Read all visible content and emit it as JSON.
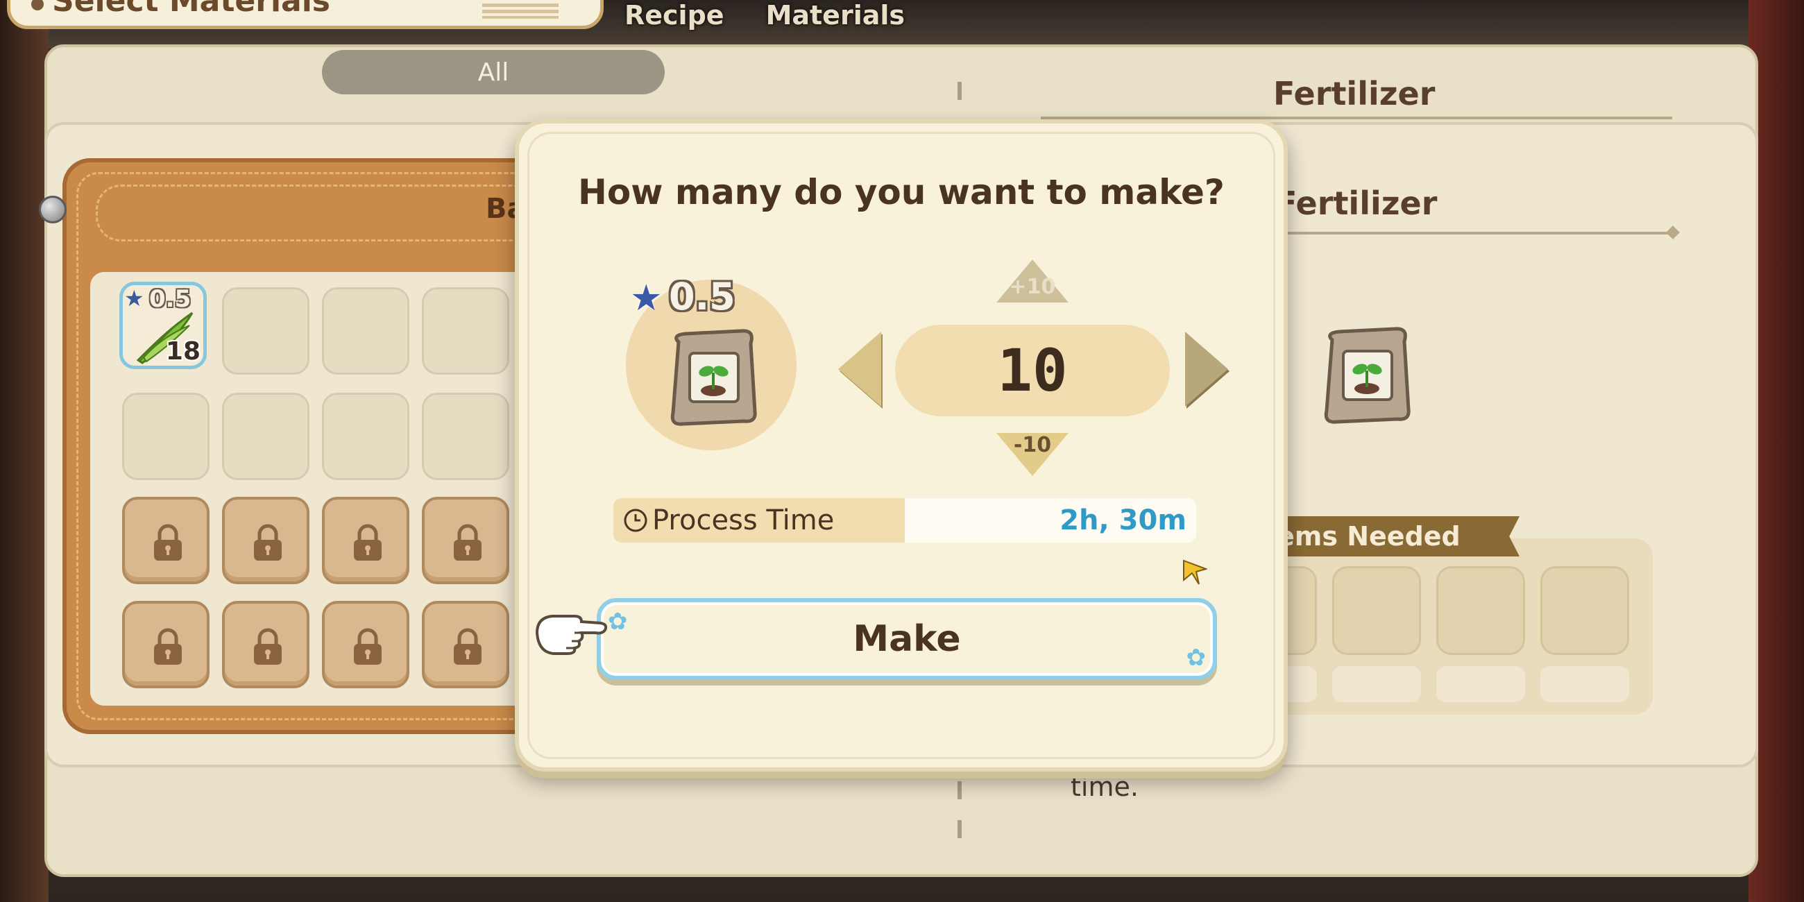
{
  "header": {
    "title": "Select Materials",
    "tabs": [
      {
        "label": "Recipe"
      },
      {
        "label": "Materials"
      }
    ]
  },
  "filter": {
    "all_label": "All"
  },
  "bag": {
    "label": "Ba",
    "items": [
      {
        "rating": "0.5",
        "count": "18",
        "icon": "grass-leaf-icon"
      }
    ]
  },
  "detail": {
    "title_back": "Fertilizer",
    "title": "Fertilizer",
    "items_needed_label": "ems Needed",
    "description_tail": "time."
  },
  "dialog": {
    "question": "How many do you want to make?",
    "product_rating": "0.5",
    "quantity": "10",
    "step_up_label": "+10",
    "step_down_label": "-10",
    "process_time_label": "Process Time",
    "process_time_value": "2h, 30m",
    "make_label": "Make"
  },
  "colors": {
    "accent_blue": "#2f9ac6",
    "button_border": "#8fd0e8",
    "leather": "#c98a4a"
  }
}
